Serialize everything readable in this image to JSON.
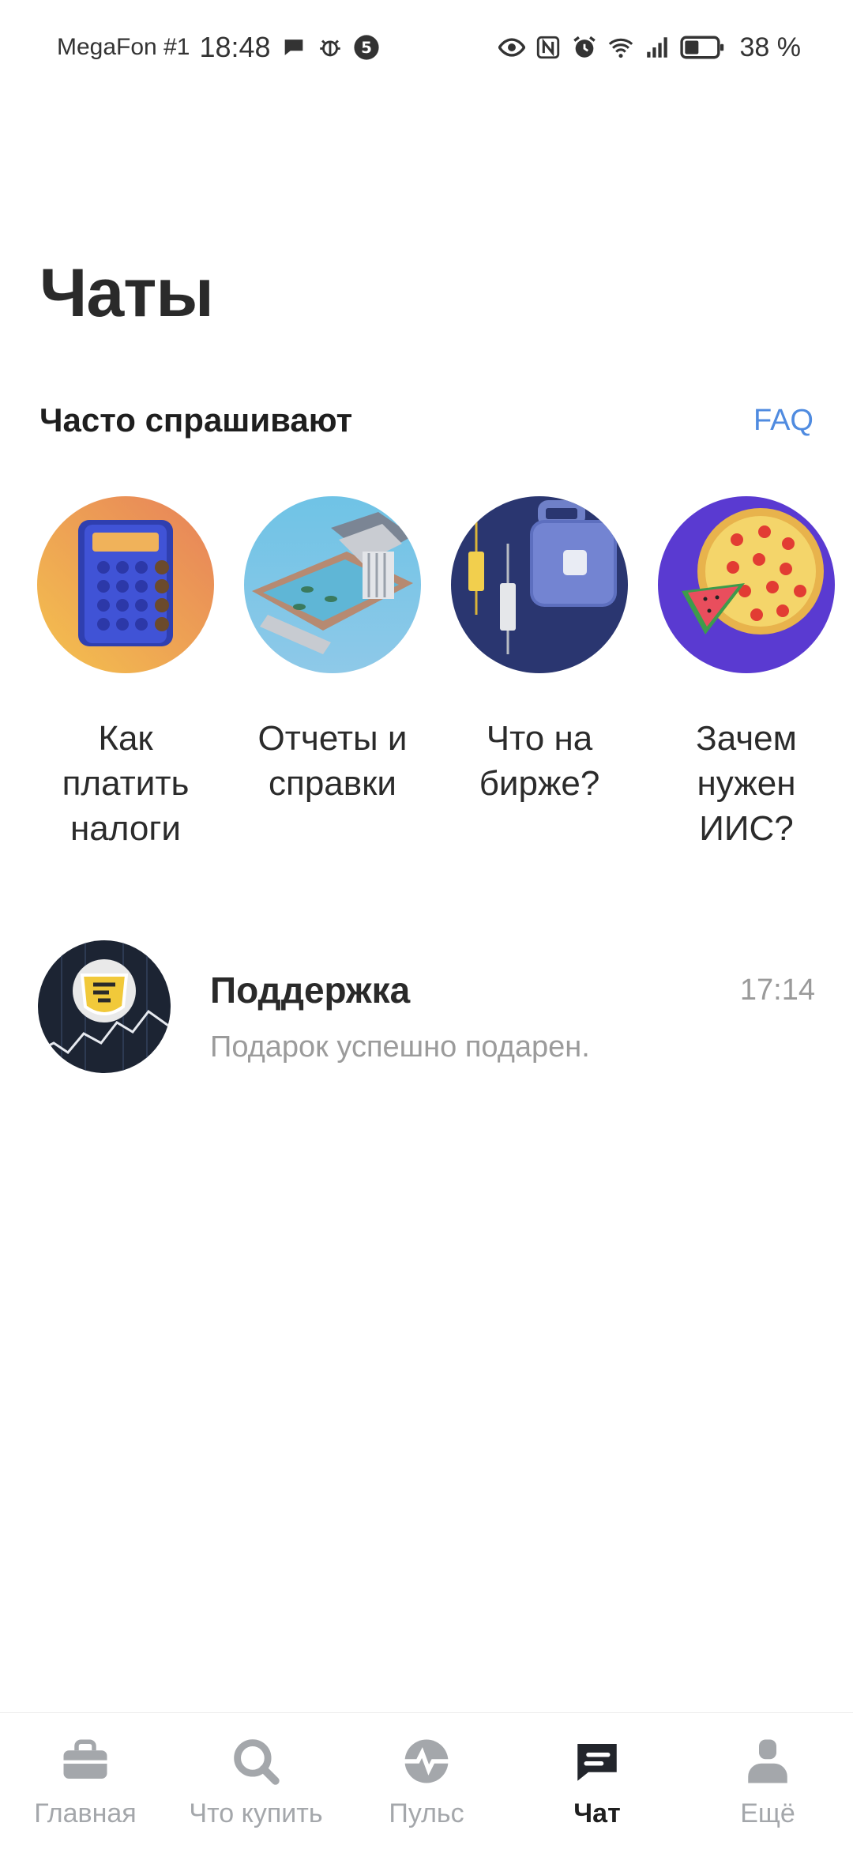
{
  "status_bar": {
    "carrier": "MegaFon #1",
    "time": "18:48",
    "notification_count": "5",
    "battery": "38 %",
    "left_icons": [
      "chat-bubble-icon",
      "bug-icon",
      "badge-icon"
    ],
    "right_icons": [
      "eye-icon",
      "nfc-icon",
      "alarm-icon",
      "wifi-icon",
      "signal-icon",
      "battery-icon"
    ]
  },
  "page": {
    "title": "Чаты"
  },
  "faq_section": {
    "title": "Часто спрашивают",
    "link_label": "FAQ",
    "link_color": "#4f8be0",
    "items": [
      {
        "label": "Как\nплатить\nналоги",
        "icon": "calculator-icon"
      },
      {
        "label": "Отчеты и\nсправки",
        "icon": "building-icon"
      },
      {
        "label": "Что на\nбирже?",
        "icon": "candlestick-briefcase-icon"
      },
      {
        "label": "Зачем\nнужен\nИИС?",
        "icon": "pizza-icon"
      }
    ]
  },
  "chats": [
    {
      "name": "Поддержка",
      "time": "17:14",
      "preview": "Подарок успешно подарен.",
      "avatar": "tinkoff-logo-icon"
    }
  ],
  "tab_bar": {
    "active_color": "#1f1f1f",
    "inactive_color": "#a4a7ab",
    "tabs": [
      {
        "label": "Главная",
        "icon": "briefcase-icon",
        "active": false
      },
      {
        "label": "Что купить",
        "icon": "search-icon",
        "active": false
      },
      {
        "label": "Пульс",
        "icon": "pulse-icon",
        "active": false
      },
      {
        "label": "Чат",
        "icon": "chat-icon",
        "active": true
      },
      {
        "label": "Ещё",
        "icon": "profile-icon",
        "active": false
      }
    ]
  }
}
